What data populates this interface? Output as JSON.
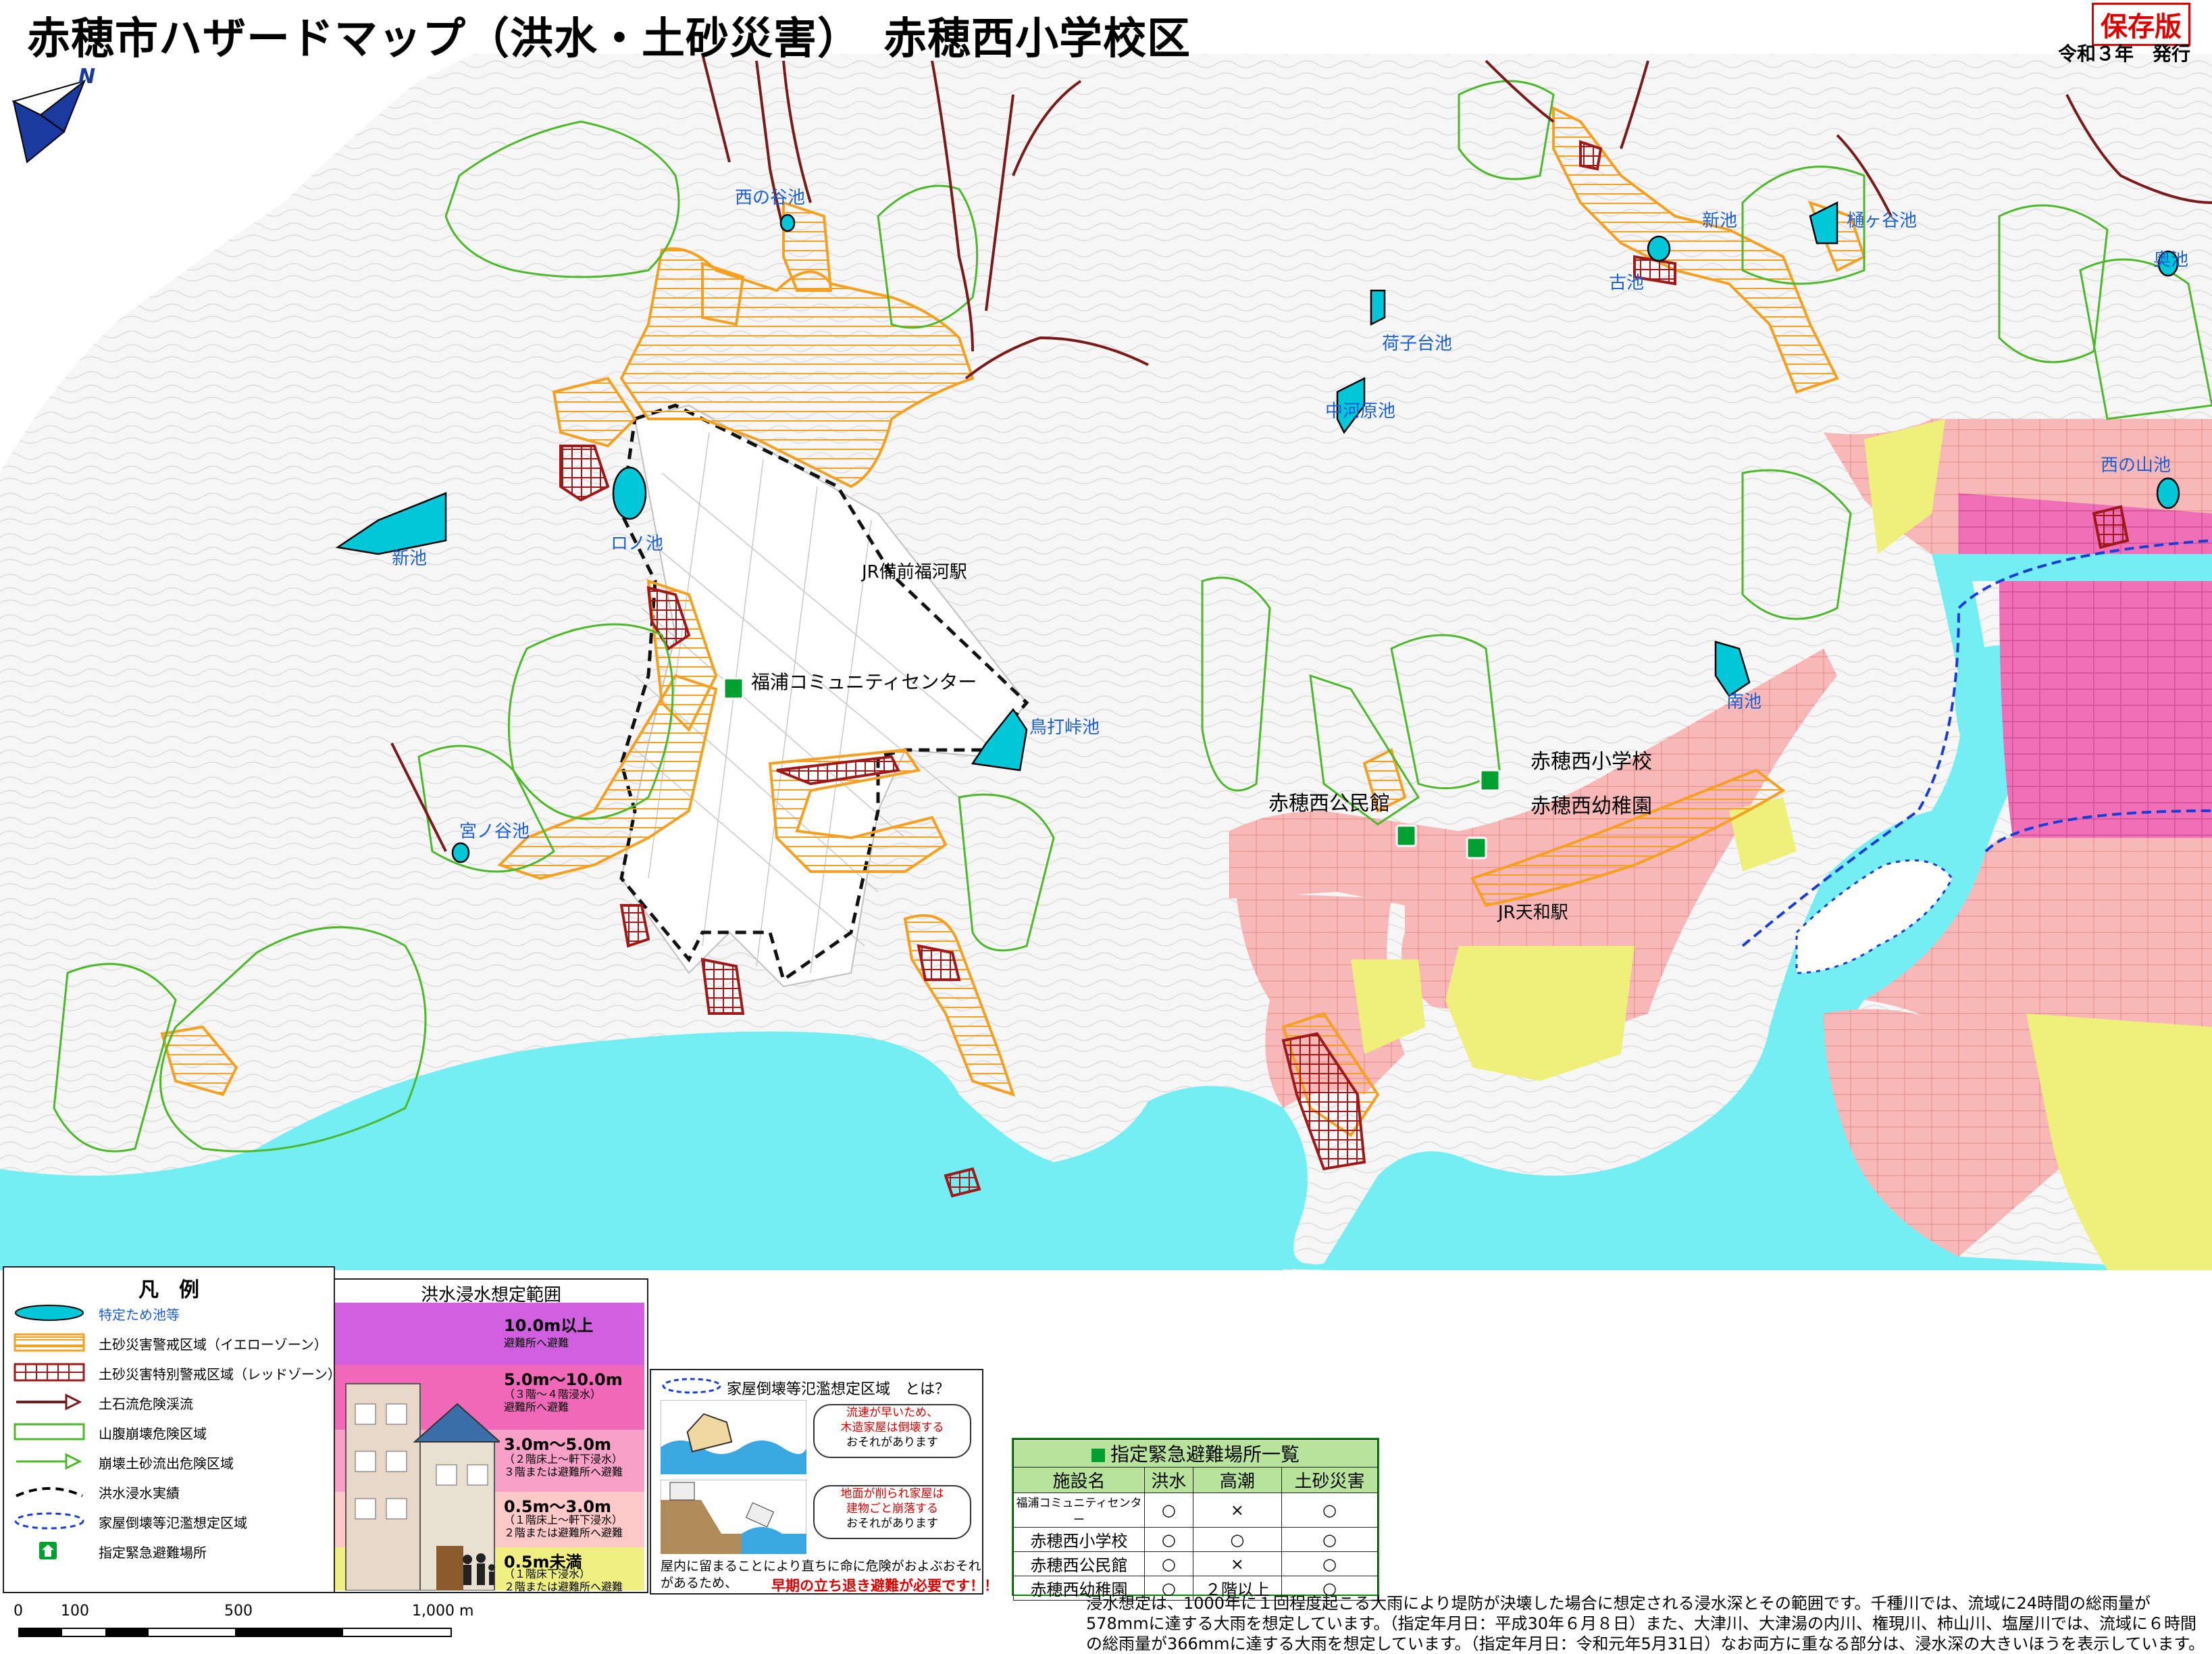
{
  "title": "赤穂市ハザードマップ（洪水・土砂災害）　赤穂西小学校区",
  "badge": "保存版",
  "issued": "令和３年　発行",
  "compass": {
    "north": "N"
  },
  "ponds": [
    {
      "name": "西の谷池"
    },
    {
      "name": "新池"
    },
    {
      "name": "ロノ池"
    },
    {
      "name": "宮ノ谷池"
    },
    {
      "name": "鳥打峠池"
    },
    {
      "name": "荷子台池"
    },
    {
      "name": "中河原池"
    },
    {
      "name": "古池"
    },
    {
      "name": "新池"
    },
    {
      "name": "樋ヶ谷池"
    },
    {
      "name": "奥池"
    },
    {
      "name": "西の山池"
    },
    {
      "name": "南池"
    }
  ],
  "places": {
    "station_fukura": "JR備前福河駅",
    "community_center": "福浦コミュニティセンター",
    "school": "赤穂西小学校",
    "public_hall": "赤穂西公民館",
    "kindergarten": "赤穂西幼稚園",
    "station_tenwa": "JR天和駅"
  },
  "legend": {
    "title": "凡　例",
    "items": [
      {
        "label": "特定ため池等",
        "color": "#00c8d8",
        "icon": "pond-icon"
      },
      {
        "label": "土砂災害警戒区域（イエローゾーン）",
        "color": "#f5a020",
        "icon": "yellow-zone-icon"
      },
      {
        "label": "土砂災害特別警戒区域（レッドゾーン）",
        "color": "#a01818",
        "icon": "red-zone-icon"
      },
      {
        "label": "土石流危険渓流",
        "color": "#7a1a1a",
        "icon": "debris-flow-icon"
      },
      {
        "label": "山腹崩壊危険区域",
        "color": "#4cb82a",
        "icon": "slope-collapse-icon"
      },
      {
        "label": "崩壊土砂流出危険区域",
        "color": "#4cb82a",
        "icon": "sediment-outflow-icon"
      },
      {
        "label": "洪水浸水実績",
        "color": "#000000",
        "icon": "flood-record-icon"
      },
      {
        "label": "家屋倒壊等氾濫想定区域",
        "color": "#1a3cd8",
        "icon": "house-collapse-icon"
      },
      {
        "label": "指定緊急避難場所",
        "color": "#00a030",
        "icon": "shelter-icon"
      }
    ]
  },
  "flood_legend": {
    "title": "洪水浸水想定範囲",
    "bands": [
      {
        "depth": "10.0m以上",
        "sub": "避難所へ避難",
        "color": "#d060e0"
      },
      {
        "depth": "5.0m～10.0m",
        "sub": "（３階～４階浸水）\n避難所へ避難",
        "color": "#f068b8"
      },
      {
        "depth": "3.0m～5.0m",
        "sub": "（２階床上～軒下浸水）\n３階または避難所へ避難",
        "color": "#f8a0c8"
      },
      {
        "depth": "0.5m～3.0m",
        "sub": "（１階床上～軒下浸水）\n２階または避難所へ避難",
        "color": "#fcc8c8"
      },
      {
        "depth": "0.5m未満",
        "sub": "（１階床下浸水）\n２階または避難所へ避難",
        "color": "#f0f080"
      }
    ]
  },
  "collapse_info": {
    "heading": "家屋倒壊等氾濫想定区域　とは？",
    "callout1_red": "流速が早いため、\n木造家屋は倒壊する",
    "callout1_black": "おそれがあります",
    "callout2_red": "地面が削られ家屋は\n建物ごと崩落する",
    "callout2_black": "おそれがあります",
    "warning_black": "屋内に留まることにより直ちに命に危険がおよぶおそれ\nがあるため、",
    "warning_red": "早期の立ち退き避難が必要です！！"
  },
  "shelter_table": {
    "title": "指定緊急避難場所一覧",
    "headers": [
      "施設名",
      "洪水",
      "高潮",
      "土砂災害"
    ],
    "rows": [
      [
        "福浦コミュニティセンター",
        "○",
        "×",
        "○"
      ],
      [
        "赤穂西小学校",
        "○",
        "○",
        "○"
      ],
      [
        "赤穂西公民館",
        "○",
        "×",
        "○"
      ],
      [
        "赤穂西幼稚園",
        "○",
        "２階以上",
        "○"
      ]
    ]
  },
  "note": "浸水想定は、1000年に１回程度起こる大雨により堤防が決壊した場合に想定される浸水深とその範囲です。千種川では、流域に24時間の総雨量が578mmに達する大雨を想定しています。（指定年月日：平成30年６月８日）また、大津川、大津湯の内川、権現川、柿山川、塩屋川では、流域に６時間の総雨量が366mmに達する大雨を想定しています。（指定年月日：令和元年5月31日）なお両方に重なる部分は、浸水深の大きいほうを表示しています。",
  "scale": {
    "ticks": [
      "0",
      "100",
      "500",
      "1,000 m"
    ]
  }
}
